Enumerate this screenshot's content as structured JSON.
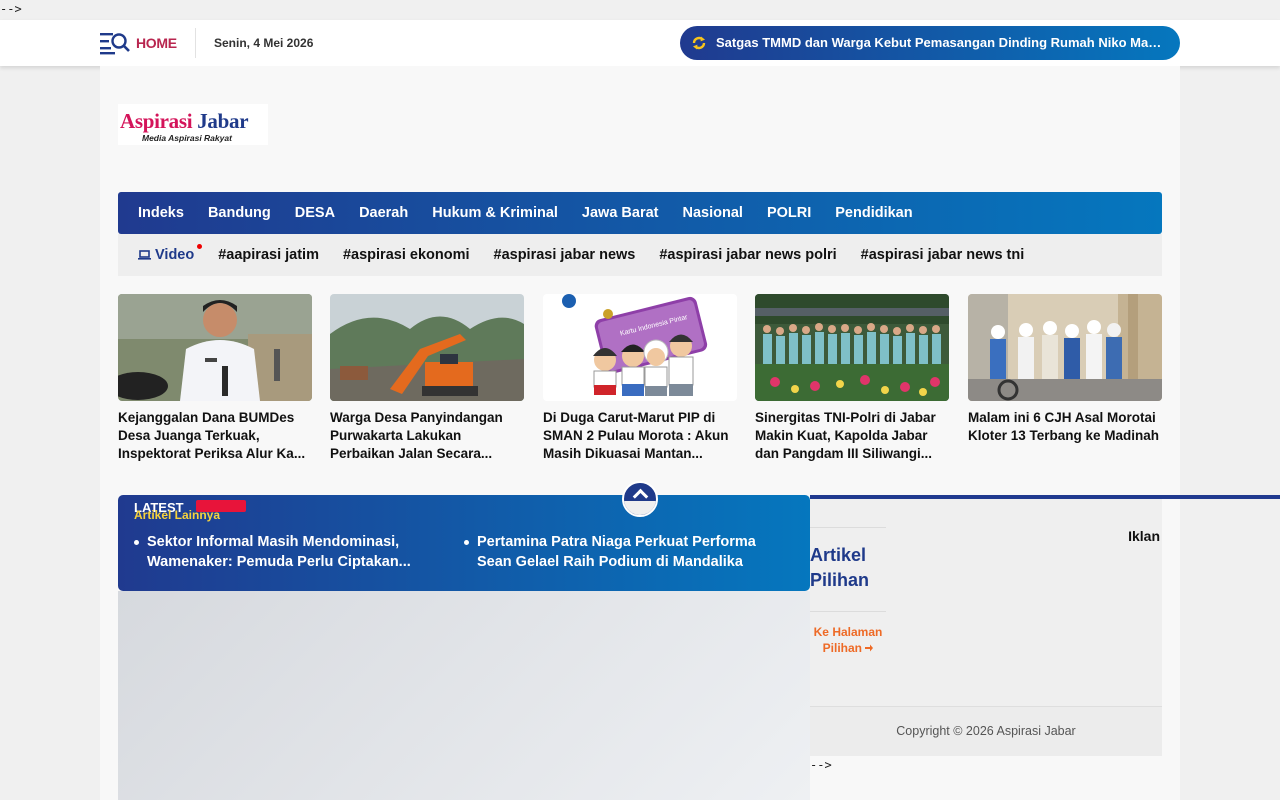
{
  "stray_comments": [
    "-->",
    "-->"
  ],
  "topbar": {
    "home_label": "HOME",
    "date": "Senin, 4 Mei 2026",
    "ticker_text": "Satgas TMMD dan Warga Kebut Pemasangan Dinding Rumah Niko Mak...",
    "icons": [
      "menu-search-icon",
      "refresh-icon"
    ]
  },
  "logo": {
    "name_part1": "Aspirasi",
    "name_part2": " Jabar",
    "tagline": "Media Aspirasi Rakyat"
  },
  "main_nav": [
    "Indeks",
    "Bandung",
    "DESA",
    "Daerah",
    "Hukum & Kriminal",
    "Jawa Barat",
    "Nasional",
    "POLRI",
    "Pendidikan"
  ],
  "tag_nav": {
    "video_label": "Video",
    "tags": [
      "#aapirasi jatim",
      "#aspirasi ekonomi",
      "#aspirasi jabar news",
      "#aspirasi jabar news polri",
      "#aspirasi jabar news tni"
    ]
  },
  "cards": [
    {
      "title": "Kejanggalan Dana BUMDes Desa Juanga Terkuak, Inspektorat Periksa Alur Ka..."
    },
    {
      "title": "Warga Desa Panyindangan Purwakarta Lakukan Perbaikan Jalan Secara..."
    },
    {
      "title": "Di Duga Carut-Marut PIP di SMAN 2 Pulau Morota : Akun Masih Dikuasai Mantan..."
    },
    {
      "title": "Sinergitas TNI-Polri di Jabar Makin Kuat, Kapolda Jabar dan Pangdam III Siliwangi..."
    },
    {
      "title": "Malam ini 6 CJH Asal Morotai Kloter 13 Terbang ke Madinah"
    }
  ],
  "card_image_text": "Kartu Indonesia Pintar",
  "latest": {
    "title": "LATEST",
    "label": "Artikel Lainnya",
    "items": [
      "Sektor Informal Masih Mendominasi, Wamenaker: Pemuda Perlu Ciptakan...",
      "Pertamina Patra Niaga Perkuat Performa Sean Gelael Raih Podium di Mandalika"
    ]
  },
  "sidebar": {
    "heading": "Artikel Pilihan",
    "link": "Ke Halaman Pilihan",
    "iklan": "Iklan"
  },
  "footer": {
    "copyright": "Copyright © 2026 Aspirasi Jabar"
  },
  "colors": {
    "brand_blue": "#203a8f",
    "brand_blue_light": "#0577be",
    "brand_pink": "#d4145a",
    "home_red": "#b8264f",
    "accent_orange": "#ee6a26",
    "accent_yellow": "#f7d33c"
  }
}
